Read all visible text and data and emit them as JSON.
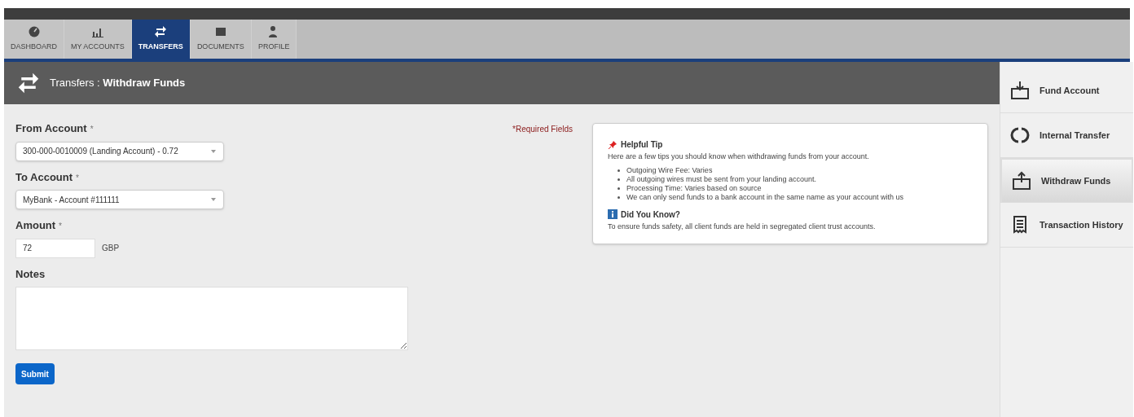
{
  "nav_tabs": [
    {
      "label": "DASHBOARD",
      "selected": false
    },
    {
      "label": "MY ACCOUNTS",
      "selected": false
    },
    {
      "label": "TRANSFERS",
      "selected": true
    },
    {
      "label": "DOCUMENTS",
      "selected": false
    },
    {
      "label": "PROFILE",
      "selected": false
    }
  ],
  "page_header": {
    "section": "Transfers",
    "separator": ":",
    "title": "Withdraw Funds"
  },
  "form": {
    "required_note": "*Required Fields",
    "fields": [
      {
        "kind": "select",
        "label": "From Account",
        "required_mark": "*",
        "value": "300-000-0010009 (Landing Account) - 0.72"
      },
      {
        "kind": "select",
        "label": "To Account",
        "required_mark": "*",
        "value": "MyBank - Account #111111"
      },
      {
        "kind": "amount",
        "label": "Amount",
        "required_mark": "*",
        "value": "72",
        "unit": "GBP"
      },
      {
        "kind": "textarea",
        "label": "Notes"
      }
    ],
    "submit": "Submit"
  },
  "tip_card": {
    "title": "Helpful Tip",
    "intro": "Here are a few tips you should know when withdrawing funds from your account.",
    "tips": [
      "Outgoing Wire Fee: Varies",
      "All outgoing wires must be sent from your landing account.",
      "Processing Time: Varies based on source",
      "We can only send funds to a bank account in the same name as your account with us"
    ],
    "did_you_know_title": "Did You Know?",
    "did_you_know_text": "To ensure funds safety, all client funds are held in segregated client trust accounts."
  },
  "sidebar": {
    "items": [
      {
        "label": "Fund Account",
        "selected": false
      },
      {
        "label": "Internal Transfer",
        "selected": false
      },
      {
        "label": "Withdraw Funds",
        "selected": true
      },
      {
        "label": "Transaction History",
        "selected": false
      }
    ]
  }
}
